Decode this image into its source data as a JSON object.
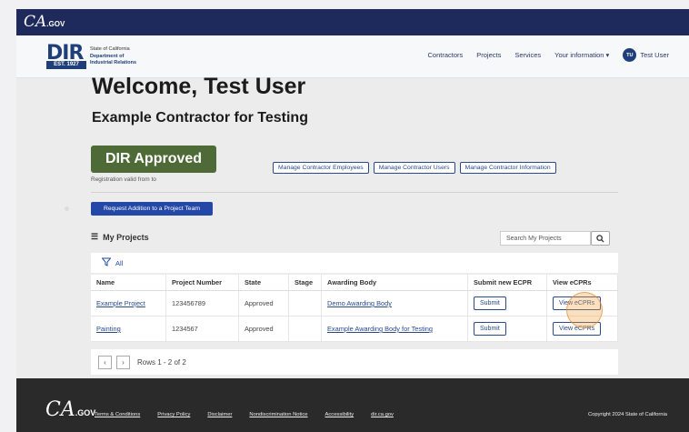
{
  "ca_bar": {
    "logo": "CA",
    "logo_suffix": ".GOV"
  },
  "header": {
    "logo_letters": "DIR",
    "logo_est": "EST. 1927",
    "logo_line1": "State of California",
    "logo_line2": "Department of",
    "logo_line3": "Industrial Relations",
    "nav": [
      "Contractors",
      "Projects",
      "Services",
      "Your information ▾"
    ],
    "avatar_initials": "TU",
    "user_name": "Test User"
  },
  "main": {
    "welcome": "Welcome, Test User",
    "company": "Example Contractor for Testing",
    "approved_badge": "DIR Approved",
    "registration": "Registration valid from to",
    "manage_buttons": [
      "Manage Contractor Employees",
      "Manage Contractor Users",
      "Manage Contractor Information"
    ],
    "request_button": "Request Addition to a Project Team"
  },
  "projects": {
    "title": "My Projects",
    "search_placeholder": "Search My Projects",
    "filter_label": "All",
    "columns": [
      "Name",
      "Project Number",
      "State",
      "Stage",
      "Awarding Body",
      "Submit new ECPR",
      "View eCPRs"
    ],
    "rows": [
      {
        "name": "Example Project",
        "number": "123456789",
        "state": "Approved",
        "stage": "",
        "body": "Demo Awarding Body",
        "submit": "Submit",
        "view": "View eCPRs"
      },
      {
        "name": "Painting",
        "number": "1234567",
        "state": "Approved",
        "stage": "",
        "body": "Example Awarding Body for Testing",
        "submit": "Submit",
        "view": "View eCPRs"
      }
    ],
    "pager_text": "Rows 1 - 2 of 2"
  },
  "footer": {
    "logo": "CA",
    "logo_suffix": ".GOV",
    "links": [
      "Terms & Conditions",
      "Privacy Policy",
      "Disclaimer",
      "Nondiscrimination Notice",
      "Accessibility",
      "dir.ca.gov"
    ],
    "copyright": "Copyright 2024 State of California"
  },
  "colors": {
    "ca_bar": "#1f2a5c",
    "approved": "#4e6a36",
    "primary": "#2348a8",
    "footer": "#2a2a2a",
    "highlight": "#f0a546"
  }
}
